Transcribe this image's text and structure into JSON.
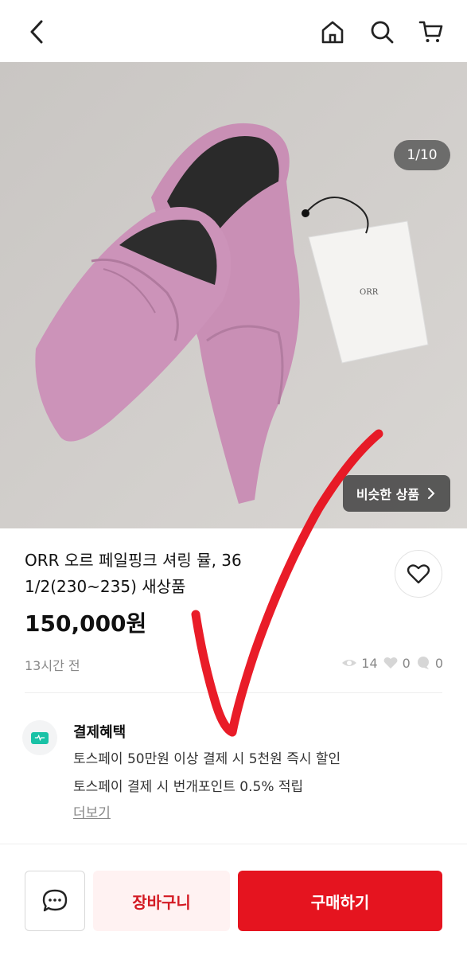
{
  "header": {
    "back_icon": "back-arrow-icon",
    "home_icon": "home-icon",
    "search_icon": "search-icon",
    "cart_icon": "cart-icon"
  },
  "image": {
    "counter": "1/10",
    "similar_label": "비슷한 상품",
    "tag_brand_text": "ORR"
  },
  "product": {
    "title": "ORR 오르 페일핑크 셔링 뮬, 36 1/2(230~235) 새상품",
    "price": "150,000원",
    "posted": "13시간 전",
    "views": "14",
    "likes": "0",
    "chats": "0"
  },
  "benefits": {
    "title": "결제혜택",
    "line1": "토스페이 50만원 이상 결제 시 5천원 즉시 할인",
    "line2": "토스페이 결제 시 번개포인트 0.5% 적립",
    "more": "더보기"
  },
  "actions": {
    "cart": "장바구니",
    "buy": "구매하기"
  },
  "colors": {
    "accent": "#e5141f",
    "cart_bg": "#fff2f2",
    "cart_text": "#d31a23",
    "benefit_icon": "#19c2a6"
  }
}
